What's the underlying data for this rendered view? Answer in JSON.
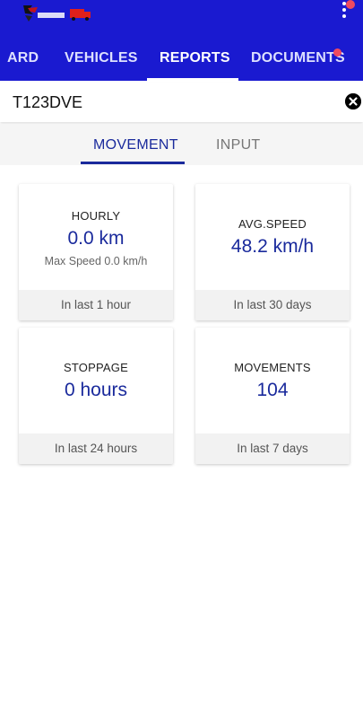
{
  "header": {
    "background_color": "#1a1ad0",
    "logo_icon": "company-logo-truck",
    "menu_icon": "more-vert-icon"
  },
  "tabs": [
    {
      "label": "ARD",
      "active": false
    },
    {
      "label": "VEHICLES",
      "active": false
    },
    {
      "label": "REPORTS",
      "active": true
    },
    {
      "label": "DOCUMENTS",
      "active": false,
      "has_badge": true
    }
  ],
  "search": {
    "value": "T123DVE",
    "clear_icon": "clear-circle-icon"
  },
  "subtabs": [
    {
      "label": "MOVEMENT",
      "active": true
    },
    {
      "label": "INPUT",
      "active": false
    }
  ],
  "cards": [
    {
      "label": "HOURLY",
      "value": "0.0 km",
      "sub": "Max Speed 0.0 km/h",
      "footer": "In last 1 hour"
    },
    {
      "label": "AVG.SPEED",
      "value": "48.2 km/h",
      "footer": "In last 30 days"
    },
    {
      "label": "STOPPAGE",
      "value": "0 hours",
      "footer": "In last 24 hours"
    },
    {
      "label": "MOVEMENTS",
      "value": "104",
      "footer": "In last 7 days"
    }
  ],
  "colors": {
    "primary": "#1a1ad0",
    "accent_text": "#1a2a9c",
    "badge": "#ef4a60"
  }
}
